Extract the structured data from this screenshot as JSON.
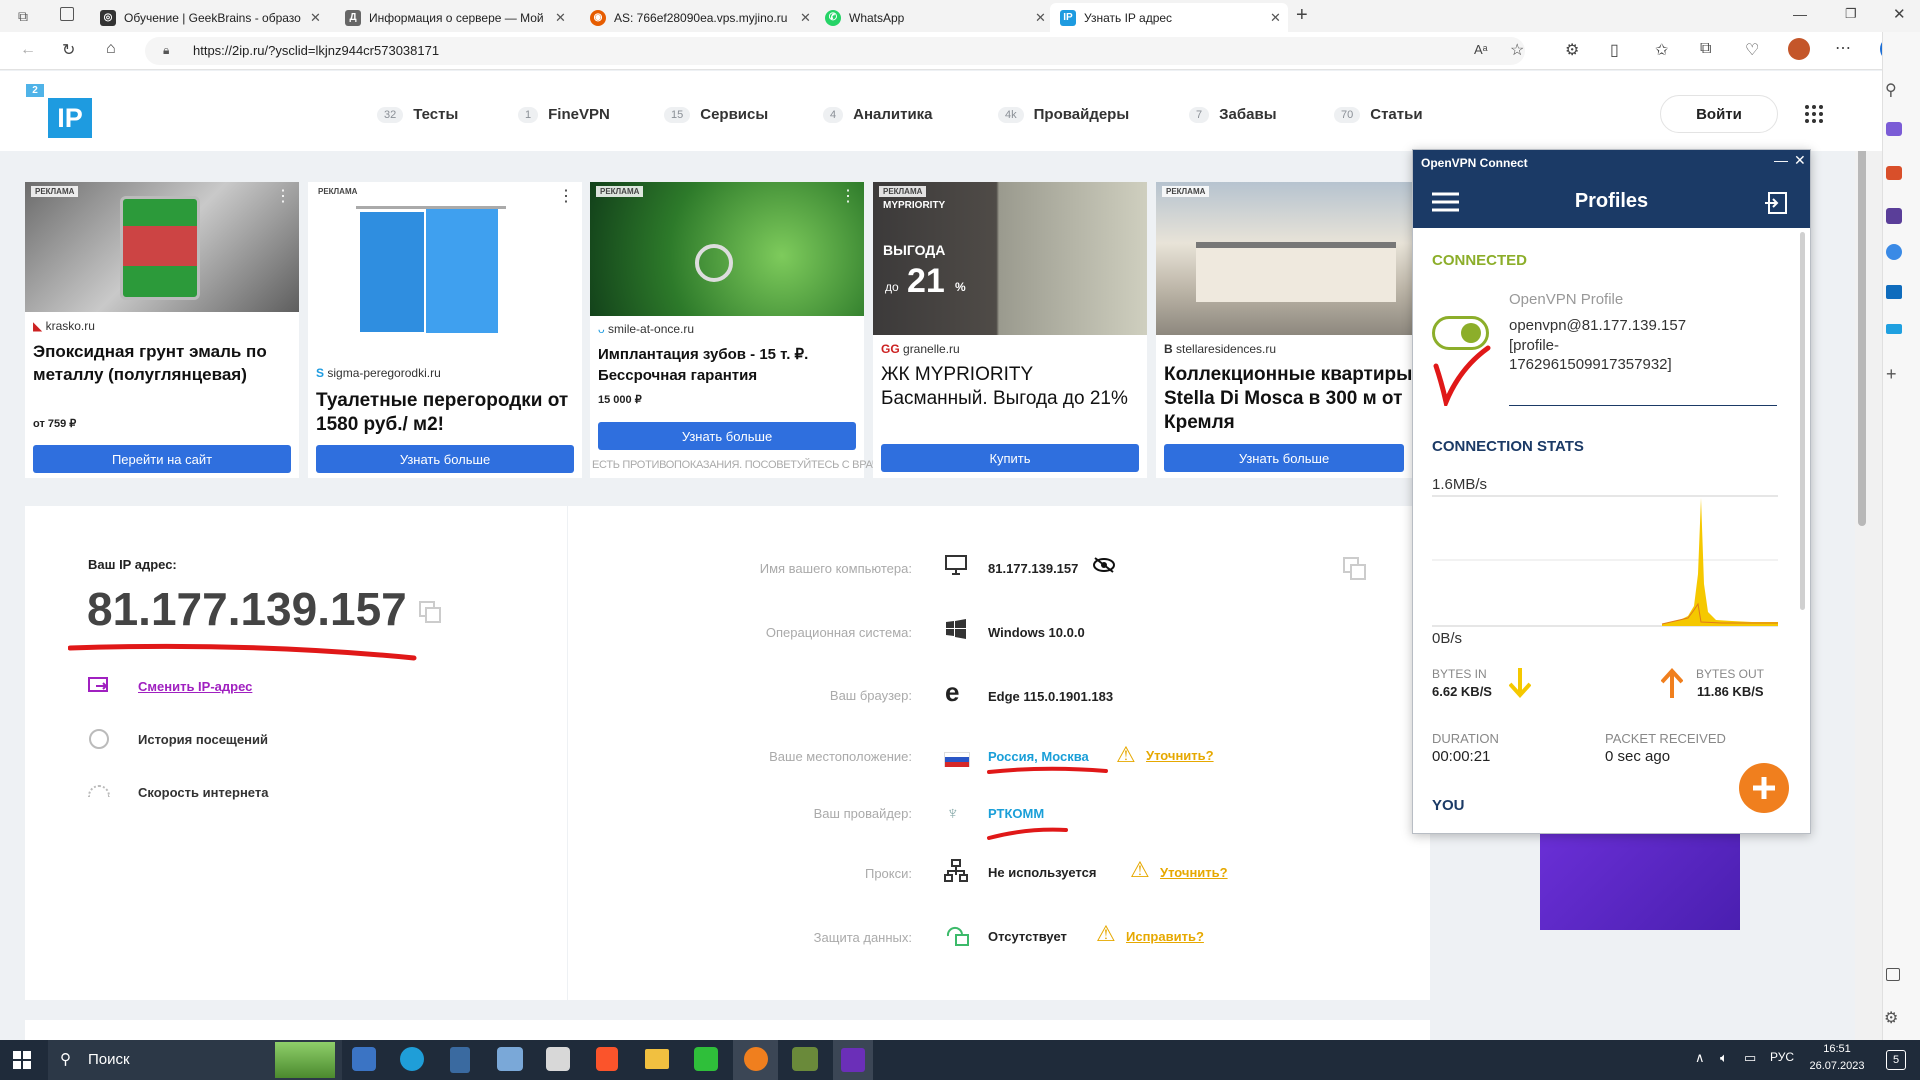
{
  "browser": {
    "tabs": [
      {
        "title": "Обучение | GeekBrains - образо",
        "fav_color": "#333",
        "fav_icon": "gb"
      },
      {
        "title": "Информация о сервере — Мой",
        "fav_color": "#555",
        "fav_icon": "Д"
      },
      {
        "title": "AS: 766ef28090ea.vps.myjino.ru",
        "fav_color": "#e65c00",
        "fav_icon": "as"
      },
      {
        "title": "WhatsApp",
        "fav_color": "#25d366",
        "fav_icon": "wa"
      },
      {
        "title": "Узнать IP адрес",
        "fav_color": "#1e9be0",
        "fav_icon": "IP"
      }
    ],
    "url": "https://2ip.ru/?ysclid=lkjnz944cr573038171"
  },
  "site": {
    "logo_small": "2",
    "logo_big": "IP",
    "nav": [
      {
        "count": "32",
        "label": "Тесты"
      },
      {
        "count": "1",
        "label": "FineVPN"
      },
      {
        "count": "15",
        "label": "Сервисы"
      },
      {
        "count": "4",
        "label": "Аналитика"
      },
      {
        "count": "4k",
        "label": "Провайдеры"
      },
      {
        "count": "7",
        "label": "Забавы"
      },
      {
        "count": "70",
        "label": "Статьи"
      }
    ],
    "login": "Войти"
  },
  "ads": [
    {
      "label": "РЕКЛАМА",
      "domain": "krasko.ru",
      "title": "Эпоксидная грунт эмаль по металлу (полуглянцевая)",
      "price": "от 759 ₽",
      "button": "Перейти на сайт",
      "note": ""
    },
    {
      "label": "РЕКЛАМА",
      "domain": "sigma-peregorodki.ru",
      "title": "Туалетные перегородки от 1580 руб./ м2!",
      "price": "",
      "button": "Узнать больше",
      "note": ""
    },
    {
      "label": "РЕКЛАМА",
      "domain": "smile-at-once.ru",
      "title": "Имплантация зубов - 15 т. ₽. Бессрочная гарантия",
      "price": "15 000 ₽",
      "button": "Узнать больше",
      "note": "ЕСТЬ ПРОТИВОПОКАЗАНИЯ. ПОСОВЕТУЙТЕСЬ С ВРАЧОМ"
    },
    {
      "label": "РЕКЛАМА",
      "domain": "granelle.ru",
      "title": "ЖК MYPRIORITY Басманный. Выгода до 21%",
      "price": "",
      "button": "Купить",
      "note": "",
      "banner_brand": "MYPRIORITY",
      "banner_line1": "ВЫГОДА",
      "banner_line2": "до",
      "banner_pct": "21",
      "banner_pct_sign": "%"
    },
    {
      "label": "РЕКЛАМА",
      "domain": "stellaresidences.ru",
      "title": "Коллекционные квартиры Stella Di Mosca в 300 м от Кремля",
      "price": "",
      "button": "Узнать больше",
      "note": ""
    }
  ],
  "ip": {
    "label": "Ваш IP адрес:",
    "value": "81.177.139.157",
    "actions": [
      "Сменить IP-адрес",
      "История посещений",
      "Скорость интернета"
    ]
  },
  "info": [
    {
      "label": "Имя вашего компьютера:",
      "value": "81.177.139.157",
      "icon": "monitor-icon",
      "extra": ""
    },
    {
      "label": "Операционная система:",
      "value": "Windows 10.0.0",
      "icon": "windows-icon",
      "extra": ""
    },
    {
      "label": "Ваш браузер:",
      "value": "Edge 115.0.1901.183",
      "icon": "edge-icon",
      "extra": ""
    },
    {
      "label": "Ваше местоположение:",
      "value": "Россия, Москва",
      "icon": "flag-icon",
      "extra": "Уточнить?"
    },
    {
      "label": "Ваш провайдер:",
      "value": "РТКОММ",
      "icon": "provider-icon",
      "extra": ""
    },
    {
      "label": "Прокси:",
      "value": "Не используется",
      "icon": "proxy-icon",
      "extra": "Уточнить?"
    },
    {
      "label": "Защита данных:",
      "value": "Отсутствует",
      "icon": "lock-icon",
      "extra": "Исправить?"
    }
  ],
  "vpn": {
    "window_title": "OpenVPN Connect",
    "header": "Profiles",
    "status": "CONNECTED",
    "profile_name": "OpenVPN Profile",
    "profile_detail_1": "openvpn@81.177.139.157",
    "profile_detail_2": "[profile-",
    "profile_detail_3": "1762961509917357932]",
    "stats_title": "CONNECTION STATS",
    "max_label": "1.6MB/s",
    "min_label": "0B/s",
    "bytes_in_label": "BYTES IN",
    "bytes_in": "6.62 KB/S",
    "bytes_out_label": "BYTES OUT",
    "bytes_out": "11.86 KB/S",
    "duration_label": "DURATION",
    "duration": "00:00:21",
    "packet_label": "PACKET RECEIVED",
    "packet": "0 sec ago",
    "you_label": "YOU"
  },
  "taskbar": {
    "search": "Поиск",
    "lang": "РУС",
    "time": "16:51",
    "date": "26.07.2023",
    "notif": "5"
  },
  "colors": {
    "accent": "#2f6fde",
    "vpn_navy": "#1b3a66",
    "connected": "#8cae2a",
    "orange": "#f07f1e"
  }
}
